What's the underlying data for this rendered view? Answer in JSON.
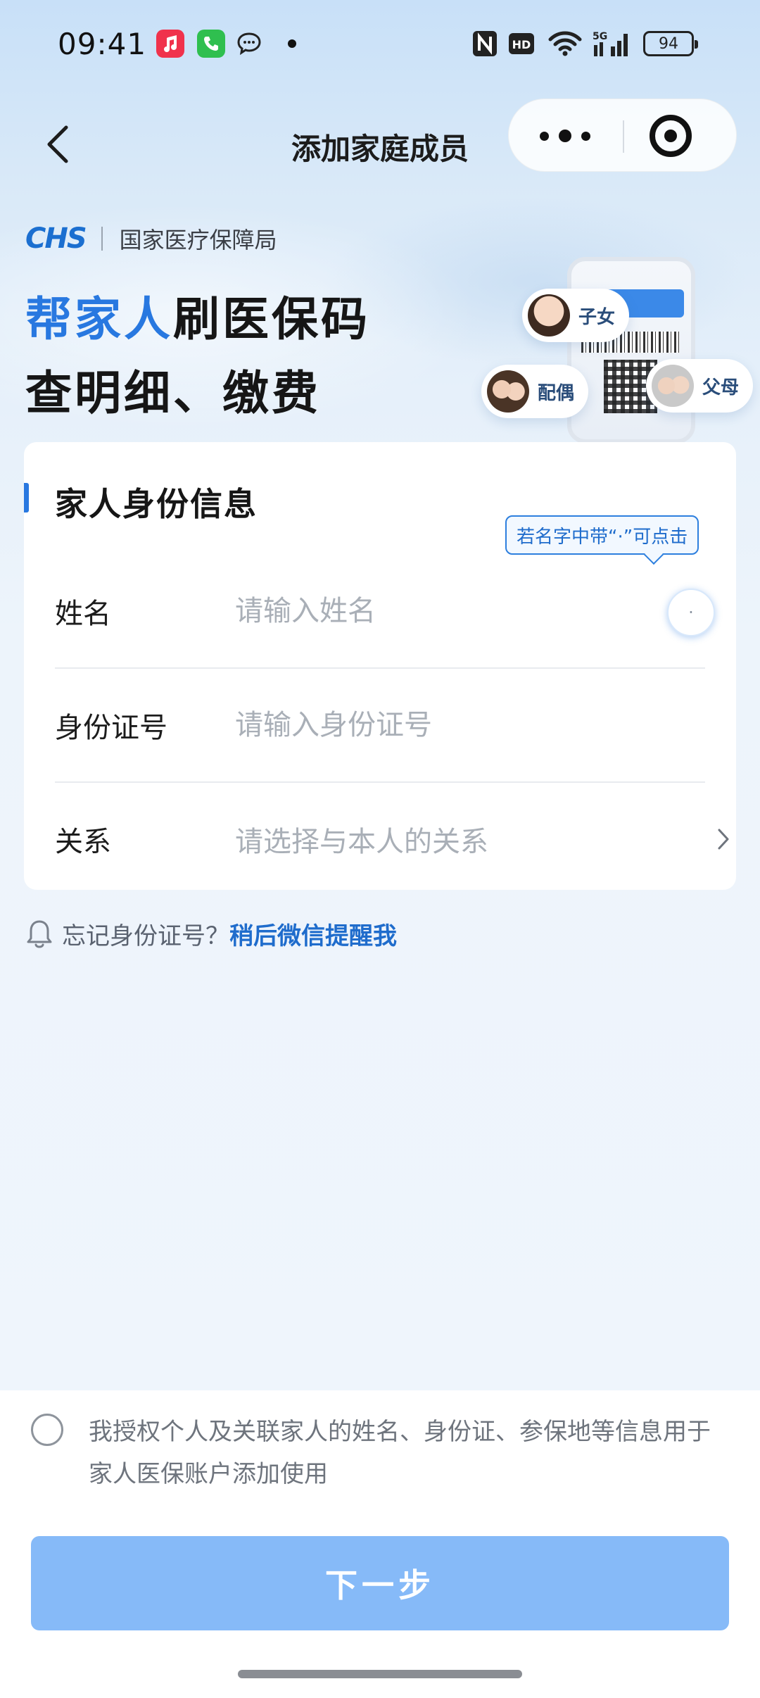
{
  "status_bar": {
    "time": "09:41",
    "battery": "94",
    "icons": [
      "music-app-icon",
      "phone-app-icon",
      "chat-app-icon",
      "nfc-icon",
      "hd-icon",
      "wifi-icon",
      "signal-5g-icon",
      "battery-icon"
    ]
  },
  "nav": {
    "title": "添加家庭成员",
    "back_icon": "chevron-left-icon",
    "more_icon": "more-dots-icon",
    "close_icon": "target-close-icon"
  },
  "hero": {
    "brand_logo": "CHS",
    "brand_name": "国家医疗保障局",
    "headline_accent": "帮家人",
    "headline_rest": "刷医保码",
    "headline_line2": "查明细、缴费",
    "bubbles": {
      "child": "子女",
      "spouse": "配偶",
      "parents": "父母"
    }
  },
  "form": {
    "section_title": "家人身份信息",
    "tooltip": "若名字中带“·”可点击",
    "name": {
      "label": "姓名",
      "placeholder": "请输入姓名",
      "dot_button": "·"
    },
    "id_number": {
      "label": "身份证号",
      "placeholder": "请输入身份证号"
    },
    "relation": {
      "label": "关系",
      "placeholder": "请选择与本人的关系"
    }
  },
  "reminder": {
    "text": "忘记身份证号？",
    "link": "稍后微信提醒我"
  },
  "consent": {
    "text": "我授权个人及关联家人的姓名、身份证、参保地等信息用于家人医保账户添加使用"
  },
  "actions": {
    "next_label": "下一步"
  },
  "colors": {
    "accent": "#2878e0",
    "link": "#1f6ccc",
    "button_disabled": "#86baf8"
  }
}
